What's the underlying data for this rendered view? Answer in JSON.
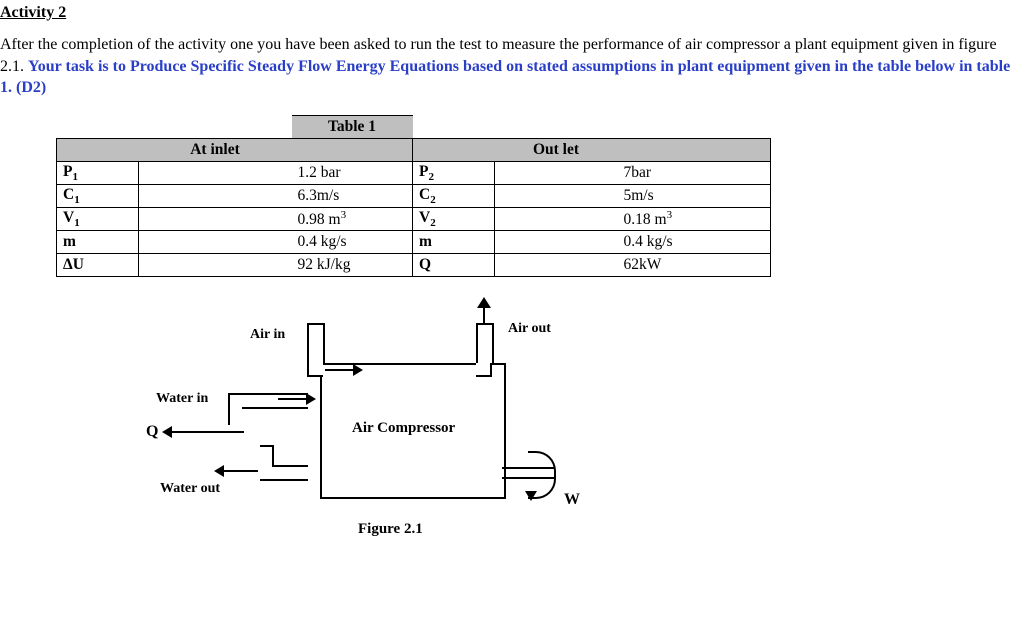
{
  "heading": "Activity 2",
  "intro_plain": "After the completion of the activity one you have been asked to run the test to measure the performance of air compressor a plant equipment given in figure 2.1. ",
  "intro_task": "Your task is to Produce Specific Steady Flow Energy Equations based on stated assumptions in plant equipment given in the table below in table 1. (D2)",
  "table": {
    "title": "Table 1",
    "inlet_header": "At inlet",
    "outlet_header": "Out let",
    "rows": [
      {
        "sym_in": "P",
        "sub_in": "1",
        "val_in": "1.2 bar",
        "sym_out": "P",
        "sub_out": "2",
        "val_out": "7bar"
      },
      {
        "sym_in": "C",
        "sub_in": "1",
        "val_in": "6.3m/s",
        "sym_out": "C",
        "sub_out": "2",
        "val_out": "5m/s"
      },
      {
        "sym_in": "V",
        "sub_in": "1",
        "val_in": "0.98 m",
        "sup_in": "3",
        "sym_out": "V",
        "sub_out": "2",
        "val_out": "0.18 m",
        "sup_out": "3"
      },
      {
        "sym_in": "m",
        "sub_in": "",
        "val_in": "0.4 kg/s",
        "sym_out": "m",
        "sub_out": "",
        "val_out": "0.4 kg/s"
      },
      {
        "sym_in": "ΔU",
        "sub_in": "",
        "val_in": "92 kJ/kg",
        "sym_out": "Q",
        "sub_out": "",
        "val_out": "62kW"
      }
    ]
  },
  "figure": {
    "air_in": "Air in",
    "air_out": "Air out",
    "water_in": "Water in",
    "water_out": "Water out",
    "q": "Q",
    "w": "W",
    "box_label": "Air Compressor",
    "caption": "Figure 2.1"
  }
}
